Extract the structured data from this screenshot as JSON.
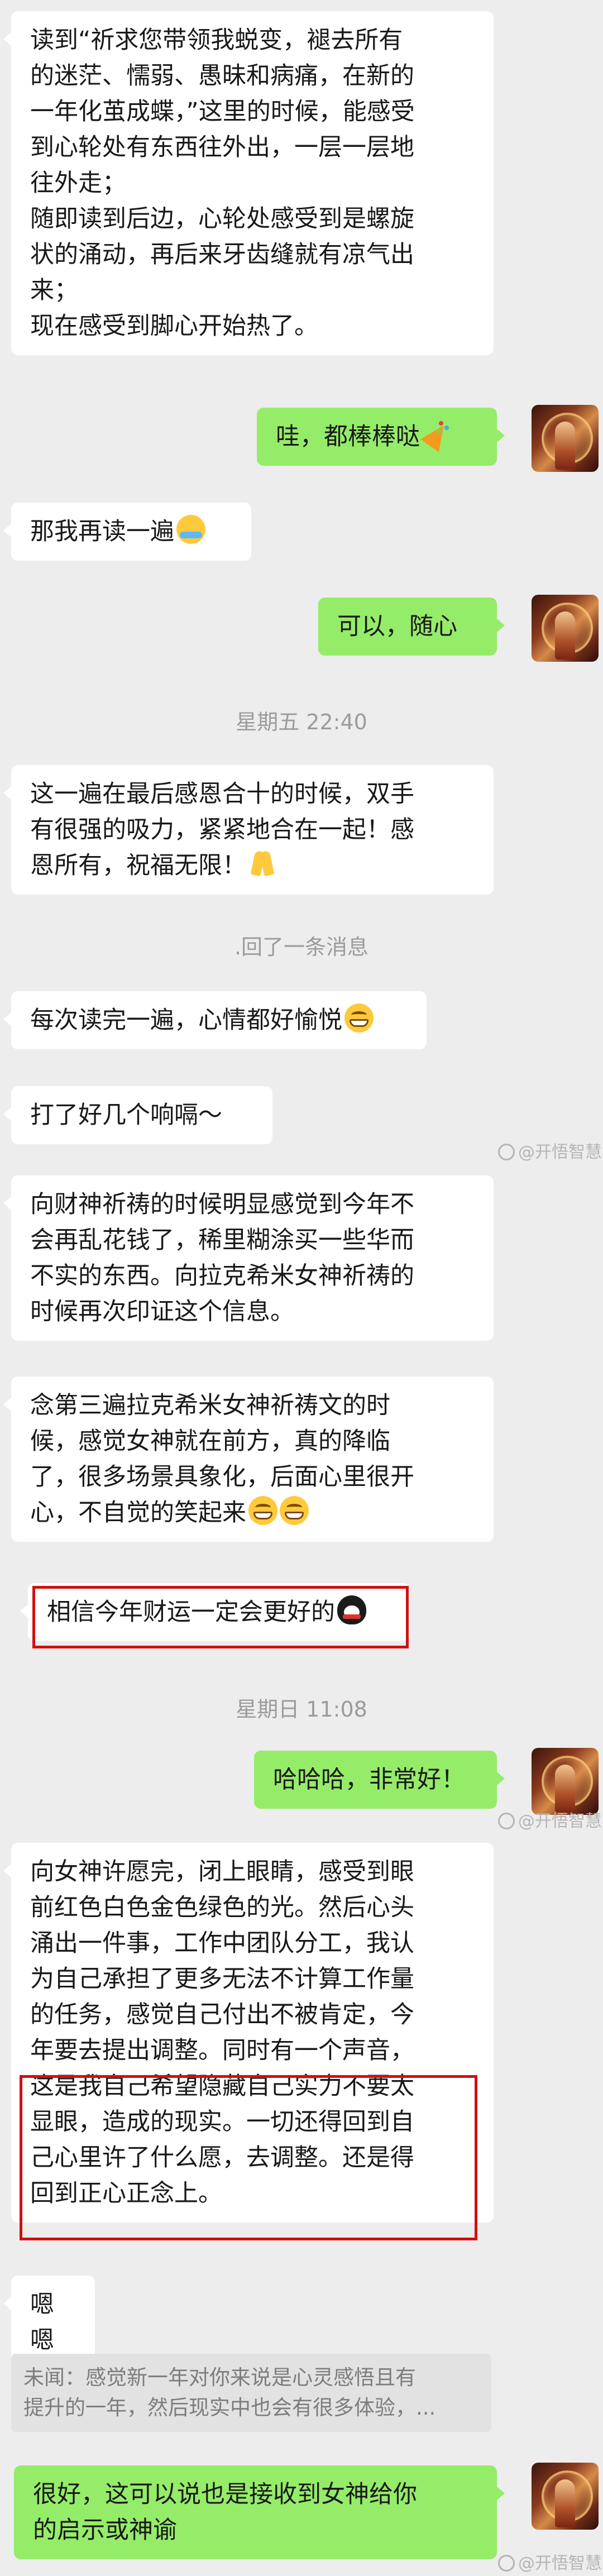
{
  "messages": {
    "m1": {
      "lines": [
        "读到“祈求您带领我蜕变，褪去所有",
        "的迷茫、懦弱、愚昧和病痛，在新的",
        "一年化茧成蝶，”这里的时候，能感受",
        "到心轮处有东西往外出，一层一层地",
        "往外走；",
        "随即读到后边，心轮处感受到是螺旋",
        "状的涌动，再后来牙齿缝就有凉气出",
        "来；",
        "现在感受到脚心开始热了。"
      ]
    },
    "m2": {
      "text": "哇，都棒棒哒",
      "emoji": "party-popper-emoji"
    },
    "m3": {
      "text": "那我再读一遍",
      "emoji": "laughing-tears-emoji"
    },
    "m4": {
      "text": "可以，随心"
    },
    "time1": "星期五 22:40",
    "m5": {
      "lines": [
        "这一遍在最后感恩合十的时候，双手",
        "有很强的吸力，紧紧地合在一起！感",
        "恩所有，祝福无限！"
      ],
      "emoji": "praying-hands-emoji"
    },
    "recall": ".回了一条消息",
    "m6": {
      "text": "每次读完一遍，心情都好愉悦",
      "emoji": "grinning-emoji"
    },
    "m7": {
      "text": "打了好几个响嗝～"
    },
    "m8": {
      "lines": [
        "向财神祈祷的时候明显感觉到今年不",
        "会再乱花钱了，稀里糊涂买一些华而",
        "不实的东西。向拉克希米女神祈祷的",
        "时候再次印证这个信息。"
      ]
    },
    "m9": {
      "lines": [
        "念第三遍拉克希米女神祈祷文的时",
        "候，感觉女神就在前方，真的降临",
        "了，很多场景具象化，后面心里很开",
        "心，不自觉的笑起来"
      ],
      "emoji": "grinning-emoji"
    },
    "m10": {
      "text": "相信今年财运一定会更好的",
      "emoji": "penguin-emoji"
    },
    "time2": "星期日 11:08",
    "m11": {
      "text": "哈哈哈，非常好！"
    },
    "m12": {
      "lines": [
        "向女神许愿完，闭上眼睛，感受到眼",
        "前红色白色金色绿色的光。然后心头",
        "涌出一件事，工作中团队分工，我认",
        "为自己承担了更多无法不计算工作量",
        "的任务，感觉自己付出不被肯定，今",
        "年要去提出调整。同时有一个声音，",
        "这是我自己希望隐藏自己实力不要太",
        "显眼，造成的现实。一切还得回到自",
        "己心里许了什么愿，去调整。还是得",
        "回到正心正念上。"
      ]
    },
    "m13": {
      "text": "嗯嗯"
    },
    "quote": {
      "lines": [
        "未闻：感觉新一年对你来说是心灵感悟且有",
        "提升的一年，然后现实中也会有很多体验，..."
      ]
    },
    "m14": {
      "lines": [
        "很好，这可以说也是接收到女神给你",
        "的启示或神谕"
      ]
    },
    "watermarks": {
      "w1": "@开悟智慧",
      "w2": "@开悟智慧",
      "w3": "@开悟智慧"
    },
    "colors": {
      "background": "#ededed",
      "incoming_bubble": "#ffffff",
      "outgoing_bubble": "#95ec69",
      "highlight_box": "#d01010"
    }
  }
}
